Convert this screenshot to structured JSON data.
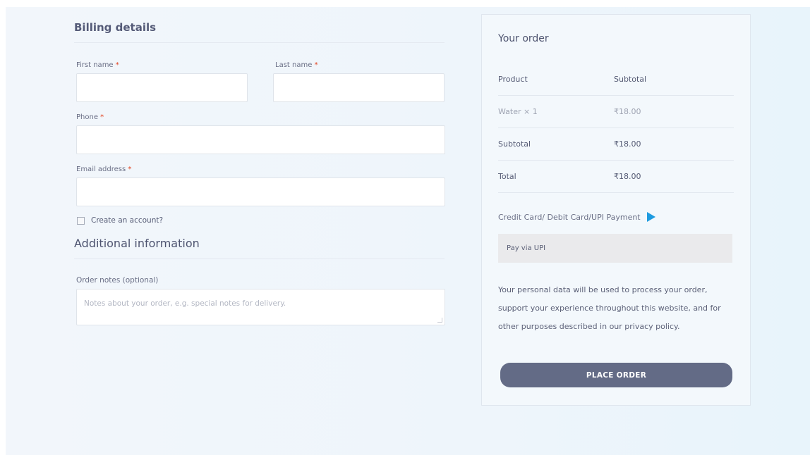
{
  "billing": {
    "title": "Billing details",
    "first_name_label": "First name",
    "last_name_label": "Last name",
    "phone_label": "Phone",
    "email_label": "Email address",
    "required_mark": "*",
    "create_account_label": "Create an account?"
  },
  "additional": {
    "title": "Additional information",
    "notes_label": "Order notes (optional)",
    "notes_placeholder": "Notes about your order, e.g. special notes for delivery."
  },
  "order": {
    "title": "Your order",
    "header": {
      "product": "Product",
      "subtotal": "Subtotal"
    },
    "items": [
      {
        "name": "Water",
        "qty": "× 1",
        "price": "₹18.00"
      }
    ],
    "subtotal": {
      "label": "Subtotal",
      "value": "₹18.00"
    },
    "total": {
      "label": "Total",
      "value": "₹18.00"
    },
    "payment_method_label": "Credit Card/ Debit Card/UPI Payment",
    "payment_icon": "upi-logo-icon",
    "payment_description": "Pay via UPI",
    "privacy_text": "Your personal data will be used to process your order, support your experience throughout this website, and for other purposes described in our privacy policy.",
    "place_order_label": "PLACE ORDER"
  },
  "colors": {
    "button_bg": "#636b86",
    "required": "#e2401c",
    "upi_icon": "#1e9be0"
  }
}
